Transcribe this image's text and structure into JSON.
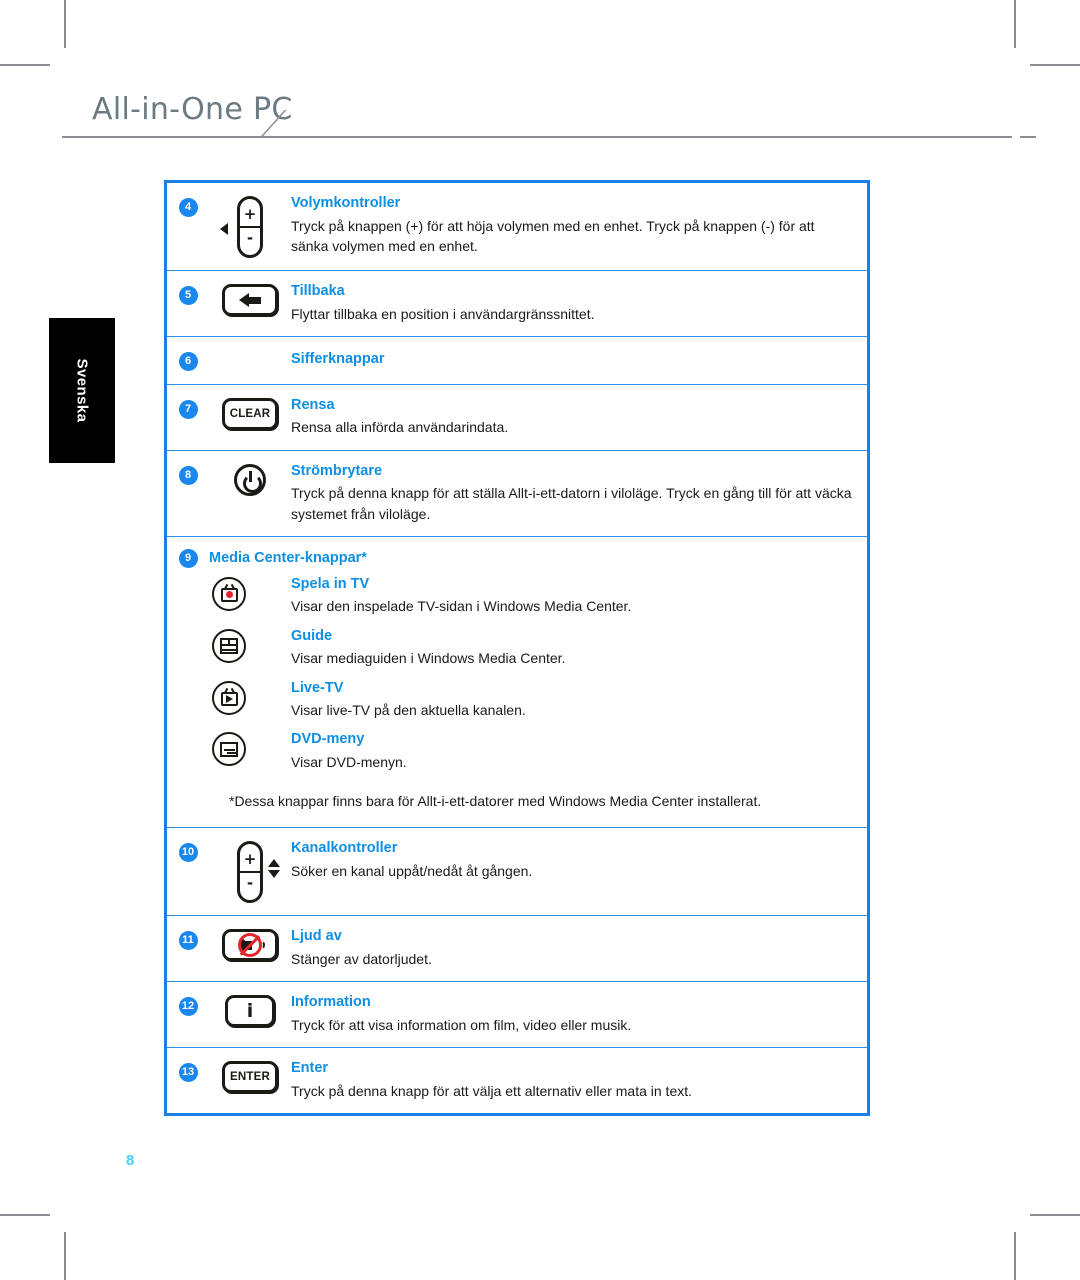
{
  "header": {
    "title": "All-in-One PC"
  },
  "sidebar": {
    "language_tab": "Svenska"
  },
  "footer": {
    "page_number": "8"
  },
  "table": {
    "rows": [
      {
        "number": "4",
        "icon": "volume-rocker-icon",
        "title": "Volymkontroller",
        "desc": "Tryck på knappen (+) för att höja volymen med en enhet. Tryck på knappen (-) för att sänka volymen med en enhet."
      },
      {
        "number": "5",
        "icon": "back-arrow-icon",
        "title": "Tillbaka",
        "desc": "Flyttar tillbaka en position i användargränssnittet."
      },
      {
        "number": "6",
        "icon": "",
        "title": "Sifferknappar",
        "desc": ""
      },
      {
        "number": "7",
        "icon": "clear-key-icon",
        "icon_label": "CLEAR",
        "title": "Rensa",
        "desc": "Rensa alla införda användarindata."
      },
      {
        "number": "8",
        "icon": "power-icon",
        "title": "Strömbrytare",
        "desc": "Tryck på denna knapp för att ställa Allt-i-ett-datorn i viloläge. Tryck en gång till för att väcka systemet från viloläge."
      }
    ],
    "media_center": {
      "number": "9",
      "title": "Media Center-knappar*",
      "items": [
        {
          "icon": "record-tv-icon",
          "title": "Spela in TV",
          "desc": "Visar den inspelade TV-sidan i Windows Media Center."
        },
        {
          "icon": "guide-icon",
          "title": "Guide",
          "desc": "Visar mediaguiden i Windows Media Center."
        },
        {
          "icon": "live-tv-icon",
          "title": "Live-TV",
          "desc": "Visar live-TV på den aktuella kanalen."
        },
        {
          "icon": "dvd-menu-icon",
          "title": "DVD-meny",
          "desc": "Visar DVD-menyn."
        }
      ],
      "footnote": "*Dessa knappar finns bara för Allt-i-ett-datorer med Windows Media Center installerat."
    },
    "rows_after": [
      {
        "number": "10",
        "icon": "channel-rocker-icon",
        "title": "Kanalkontroller",
        "desc": "Söker en kanal uppåt/nedåt åt gången."
      },
      {
        "number": "11",
        "icon": "mute-icon",
        "title": "Ljud av",
        "desc": "Stänger av datorljudet."
      },
      {
        "number": "12",
        "icon": "information-icon",
        "icon_label": "i",
        "title": "Information",
        "desc": "Tryck för att visa information om film, video eller musik."
      },
      {
        "number": "13",
        "icon": "enter-key-icon",
        "icon_label": "ENTER",
        "title": "Enter",
        "desc": "Tryck på denna knapp för att välja ett alternativ eller mata in text."
      }
    ]
  },
  "colors": {
    "brand_blue": "#1a7fe8",
    "heading_blue": "#0d8fe5",
    "badge_blue": "#1a87ef",
    "page_number_blue": "#49cdfb",
    "header_gray": "#6c7a82",
    "record_red": "#e3262b"
  }
}
